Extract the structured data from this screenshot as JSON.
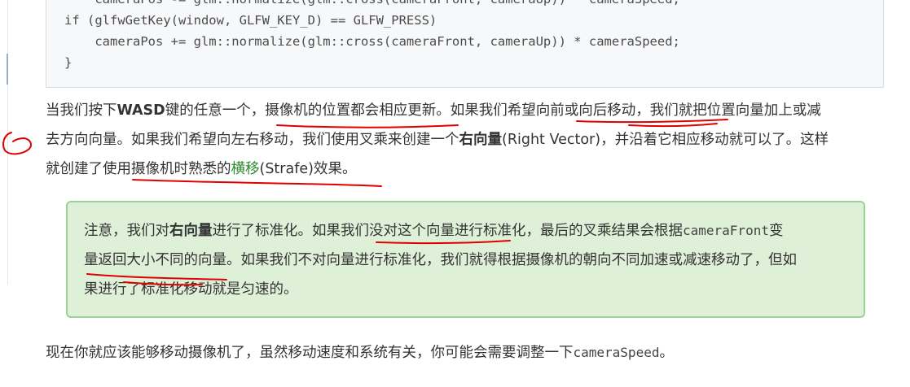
{
  "code": {
    "lines": [
      "    cameraPos -= glm::normalize(glm::cross(cameraFront, cameraUp)) * cameraSpeed;",
      "if (glfwGetKey(window, GLFW_KEY_D) == GLFW_PRESS)",
      "    cameraPos += glm::normalize(glm::cross(cameraFront, cameraUp)) * cameraSpeed;",
      "}"
    ]
  },
  "para1": {
    "l1_a": "当我们按下",
    "l1_b": "WASD",
    "l1_c": "键的任意一个，摄像机的位置都会相应更新。如果我们希望向前或向后移动，我们就把位置向量加上或减",
    "l2_a": "去方向向量。如果我们希望向左右移动，我们使用叉乘来创建一个",
    "l2_b": "右向量",
    "l2_c": "(Right Vector)，并沿着它相应移动就可以了。这样",
    "l3_a": "就创建了使用摄像机时熟悉的",
    "l3_b": "横移",
    "l3_c": "(Strafe)效果。"
  },
  "note": {
    "l1_a": "注意，我们对",
    "l1_b": "右向量",
    "l1_c": "进行了标准化。如果我们没对这个向量进行标准化，最后的叉乘结果会根据",
    "l1_d": "cameraFront",
    "l1_e": "变",
    "l2": "量返回大小不同的向量。如果我们不对向量进行标准化，我们就得根据摄像机的朝向不同加速或减速移动了，但如",
    "l3": "果进行了标准化移动就是匀速的。"
  },
  "para2": {
    "a": "现在你就应该能够移动摄像机了，虽然移动速度和系统有关，你可能会需要调整一下",
    "b": "cameraSpeed",
    "c": "。"
  },
  "annotation_color": "#e00000"
}
